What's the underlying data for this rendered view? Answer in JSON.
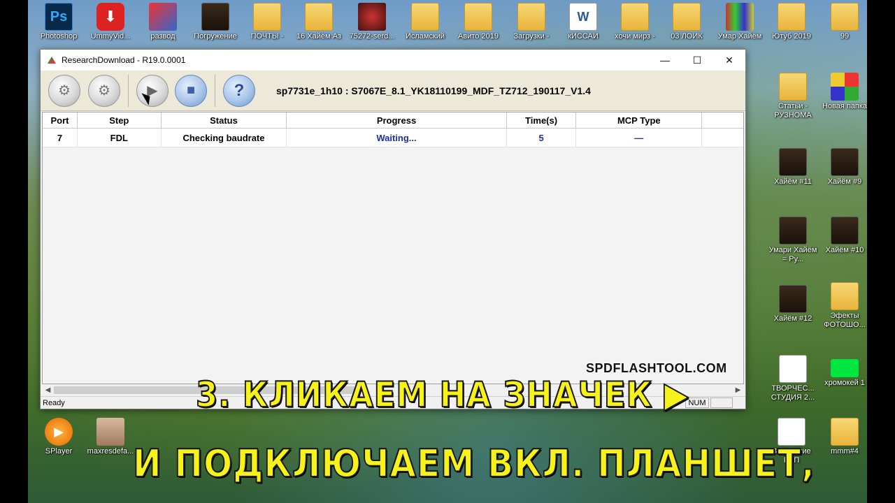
{
  "desktop": {
    "top_icons": [
      {
        "label": "Photoshop",
        "kind": "app"
      },
      {
        "label": "UmmyVid...",
        "kind": "app"
      },
      {
        "label": "развод",
        "kind": "image"
      },
      {
        "label": "Погружение",
        "kind": "video"
      },
      {
        "label": "ПОЧТЫ -",
        "kind": "folder"
      },
      {
        "label": "16 Хайём Аз",
        "kind": "folder"
      },
      {
        "label": "75272-serd...",
        "kind": "image"
      },
      {
        "label": "Исламский",
        "kind": "folder"
      },
      {
        "label": "Авито 2019",
        "kind": "folder"
      },
      {
        "label": "Загрузки -",
        "kind": "folder"
      },
      {
        "label": "кИССАИ",
        "kind": "doc"
      },
      {
        "label": "хочи мирз -",
        "kind": "folder"
      },
      {
        "label": "03 ЛОИК",
        "kind": "folder"
      },
      {
        "label": "Умар Хайём",
        "kind": "video"
      },
      {
        "label": "Ютуб 2019",
        "kind": "folder"
      },
      {
        "label": "99",
        "kind": "folder"
      }
    ],
    "right_icons": [
      {
        "label": "Статьи - РУЗНОМА",
        "kind": "folder"
      },
      {
        "label": "Новая папка",
        "kind": "app"
      },
      {
        "label": "Хайём #11",
        "kind": "video"
      },
      {
        "label": "Хайём #9",
        "kind": "video"
      },
      {
        "label": "Умари Хайём = Ру...",
        "kind": "video"
      },
      {
        "label": "Хайём #10",
        "kind": "video"
      },
      {
        "label": "Хайём #12",
        "kind": "video"
      },
      {
        "label": "Эфекты ФОТОШО...",
        "kind": "folder"
      },
      {
        "label": "ТВОРЧЕС... СТУДИЯ 2...",
        "kind": "image"
      },
      {
        "label": "хромокей 1",
        "kind": "image"
      }
    ],
    "bottom_icons": [
      {
        "label": "SPlayer",
        "kind": "app"
      },
      {
        "label": "maxresdefa...",
        "kind": "image"
      },
      {
        "label": "Заявление РВП",
        "kind": "doc"
      },
      {
        "label": "mmm#4",
        "kind": "folder"
      }
    ]
  },
  "window": {
    "title": "ResearchDownload - R19.0.0001",
    "controls": {
      "minimize": "—",
      "maximize": "☐",
      "close": "✕"
    },
    "toolbar": {
      "file_name": "sp7731e_1h10 : S7067E_8.1_YK18110199_MDF_TZ712_190117_V1.4"
    },
    "table": {
      "headers": [
        "Port",
        "Step",
        "Status",
        "Progress",
        "Time(s)",
        "MCP Type"
      ],
      "rows": [
        {
          "port": "7",
          "step": "FDL",
          "status": "Checking baudrate",
          "progress": "Waiting...",
          "time": "5",
          "mcp": "—"
        }
      ]
    },
    "statusbar": {
      "ready": "Ready",
      "num": "NUM"
    }
  },
  "overlay": {
    "watermark": "SPDFLASHTOOL.COM",
    "caption_line1": "3. КЛИКАЕМ НА ЗНАЧЕК ▶",
    "caption_line2": "И ПОДКЛЮЧАЕМ ВКЛ. ПЛАНШЕТ,"
  }
}
